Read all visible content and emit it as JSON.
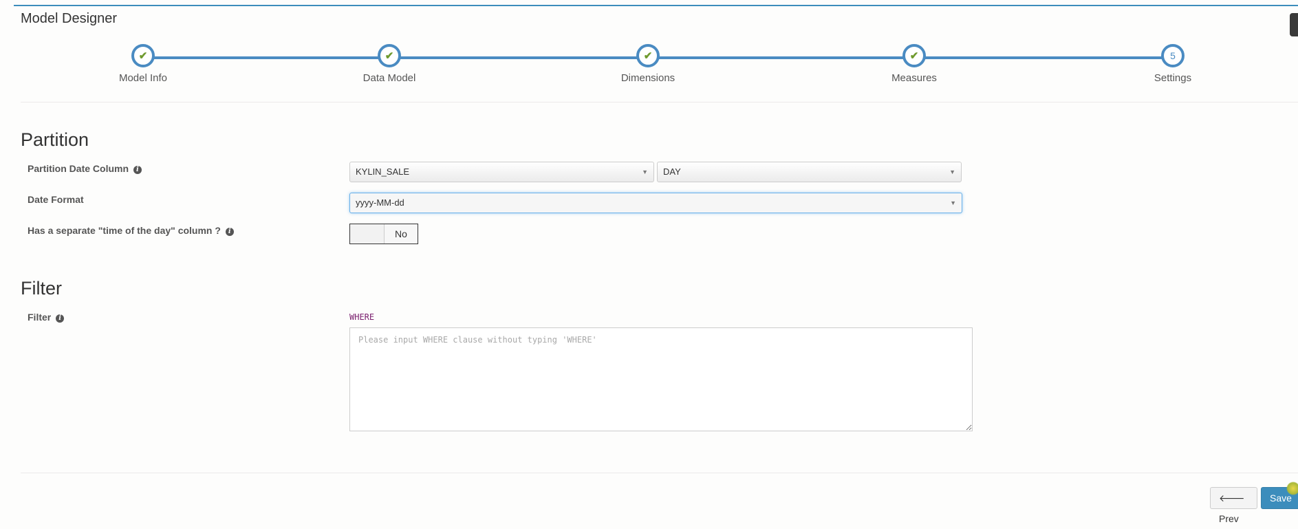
{
  "header": {
    "title": "Model Designer"
  },
  "wizard": {
    "steps": [
      {
        "label": "Model Info",
        "marker": "check-icon"
      },
      {
        "label": "Data Model",
        "marker": "check-icon"
      },
      {
        "label": "Dimensions",
        "marker": "check-icon"
      },
      {
        "label": "Measures",
        "marker": "check-icon"
      },
      {
        "label": "Settings",
        "number": "5"
      }
    ]
  },
  "partition": {
    "heading": "Partition",
    "date_column_label": "Partition Date Column",
    "table_value": "KYLIN_SALE",
    "column_value": "DAY",
    "date_format_label": "Date Format",
    "date_format_value": "yyyy-MM-dd",
    "time_column_label": "Has a separate \"time of the day\" column ?",
    "time_column_toggle": "No"
  },
  "filter": {
    "heading": "Filter",
    "label": "Filter",
    "keyword": "WHERE",
    "placeholder": "Please input WHERE clause without typing 'WHERE'"
  },
  "footer": {
    "prev_label": "Prev",
    "save_label": "Save"
  },
  "colors": {
    "accent": "#4a8bc2",
    "check": "#6f9a2e",
    "keyword": "#7a1f6e",
    "save_button": "#3c8dbc"
  }
}
